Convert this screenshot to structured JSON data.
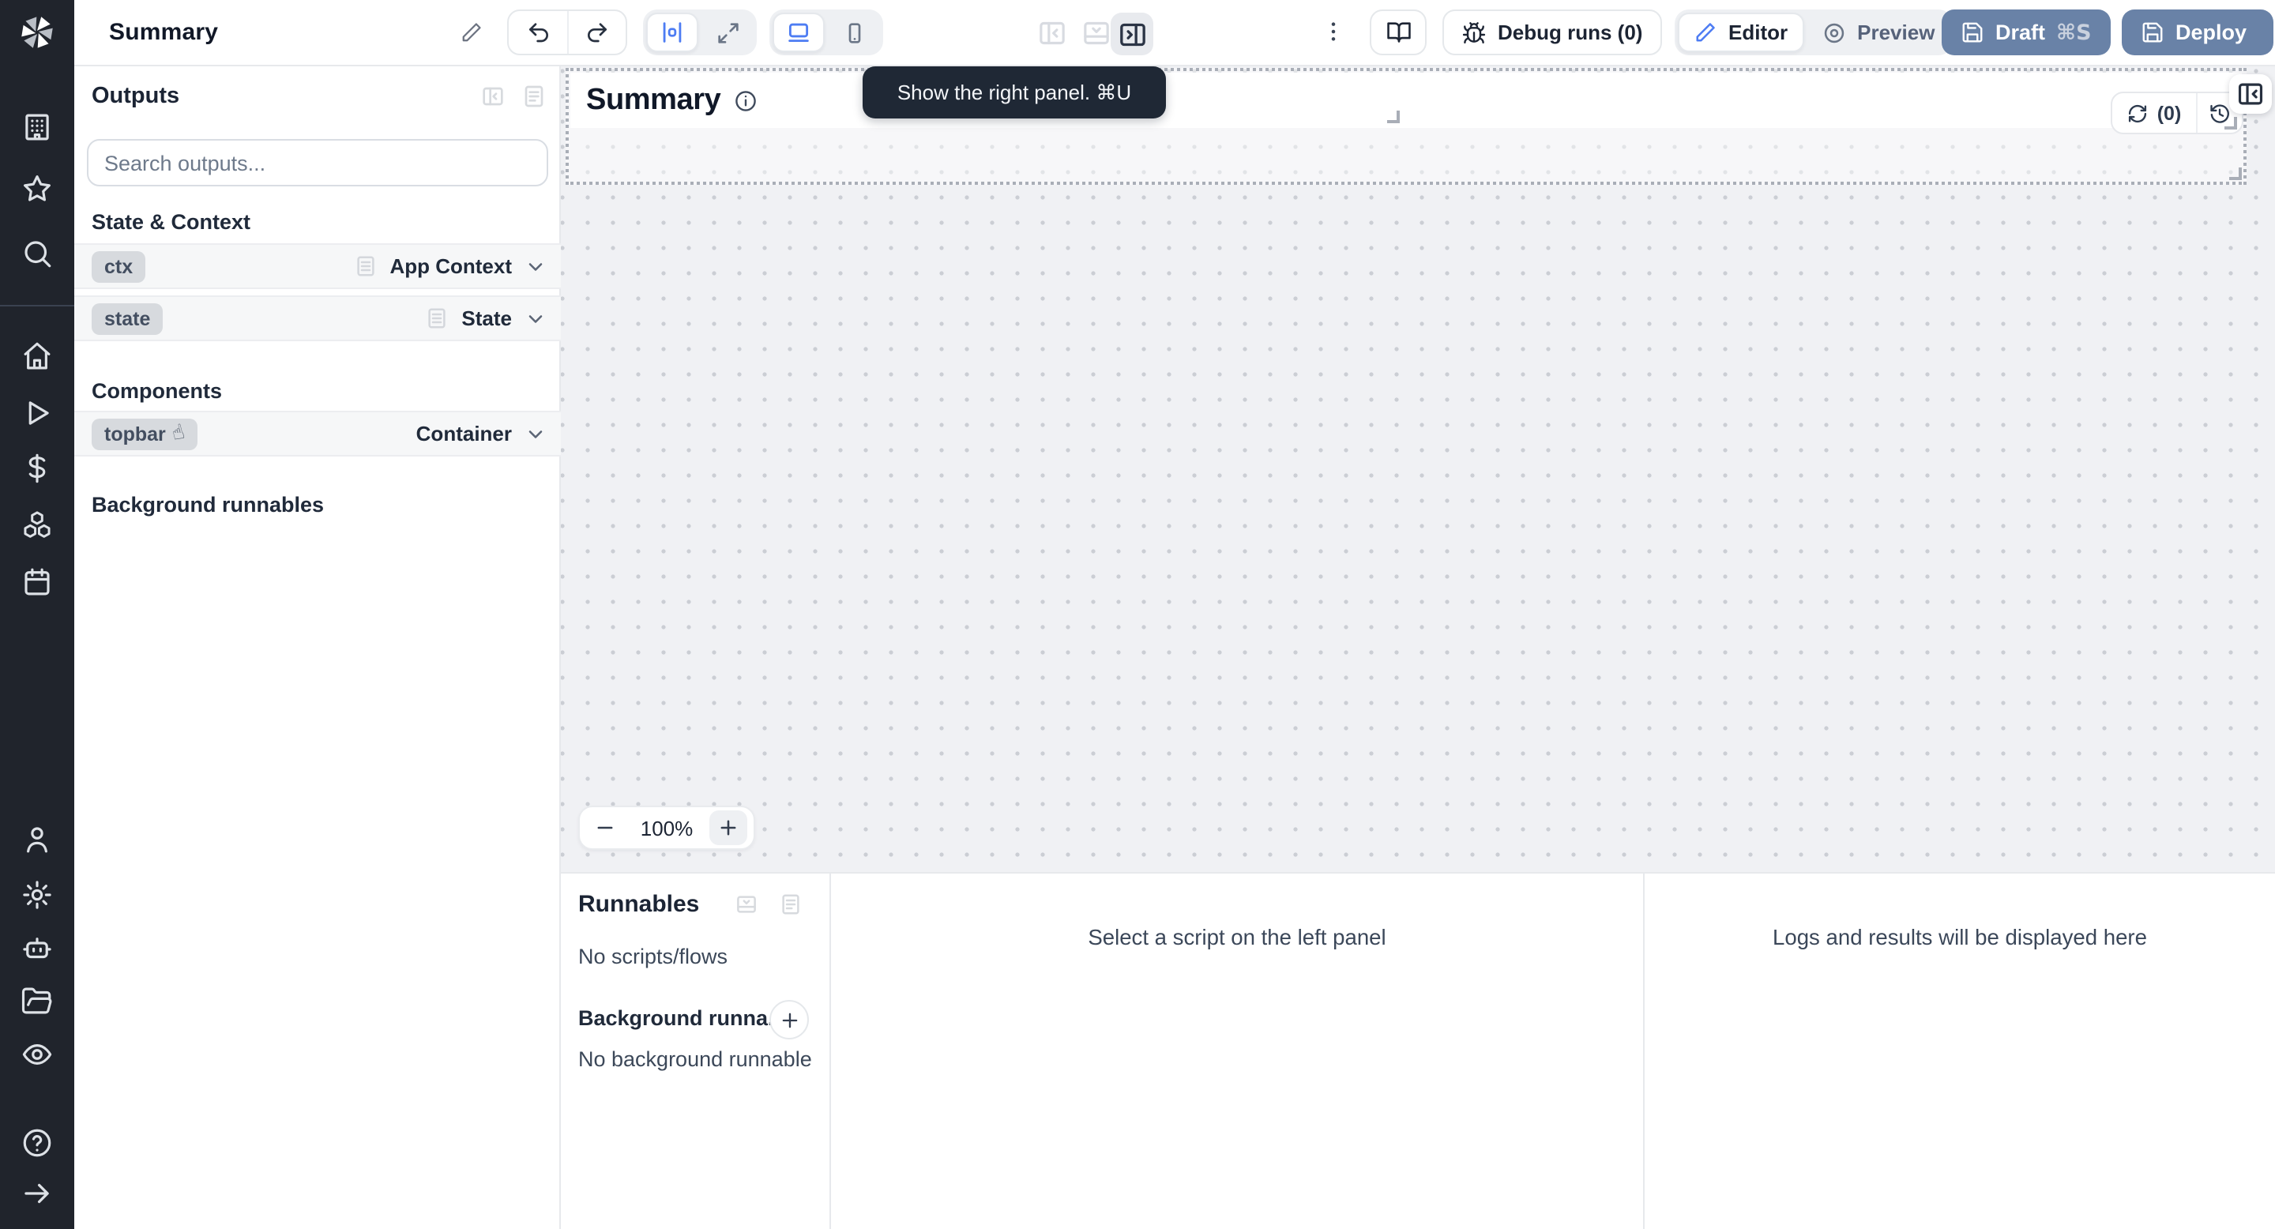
{
  "header": {
    "app_title": "Summary",
    "debug_runs_label": "Debug runs (0)",
    "editor_label": "Editor",
    "preview_label": "Preview",
    "draft_label": "Draft",
    "draft_shortcut": "⌘S",
    "deploy_label": "Deploy"
  },
  "outputs_panel": {
    "title": "Outputs",
    "search_placeholder": "Search outputs...",
    "state_context_header": "State & Context",
    "components_header": "Components",
    "background_header": "Background runnables",
    "rows": [
      {
        "id": "ctx",
        "type": "App Context"
      },
      {
        "id": "state",
        "type": "State"
      },
      {
        "id": "topbar",
        "type": "Container"
      }
    ]
  },
  "canvas": {
    "title": "Summary",
    "refresh_count": "(0)",
    "zoom_value": "100%",
    "tooltip": "Show the right panel. ⌘U"
  },
  "runnables": {
    "title": "Runnables",
    "no_scripts": "No scripts/flows",
    "background_title": "Background runna...",
    "no_background": "No background runnable"
  },
  "bottom_panels": {
    "select_script": "Select a script on the left panel",
    "logs_placeholder": "Logs and results will be displayed here"
  },
  "icons": {
    "hand_cursor": "☝",
    "sidebar": [
      "building",
      "star",
      "search",
      "home",
      "play",
      "dollar-sign",
      "boxes",
      "calendar",
      "user",
      "settings",
      "bot",
      "folder-open",
      "eye",
      "help-circle",
      "arrow-right"
    ]
  },
  "colors": {
    "accent_blue": "#4d7cf3",
    "deploy_button": "#6982a7",
    "sidebar_bg": "#20242c",
    "tooltip_bg": "#1f2835",
    "canvas_bg": "#f0f1f4"
  }
}
